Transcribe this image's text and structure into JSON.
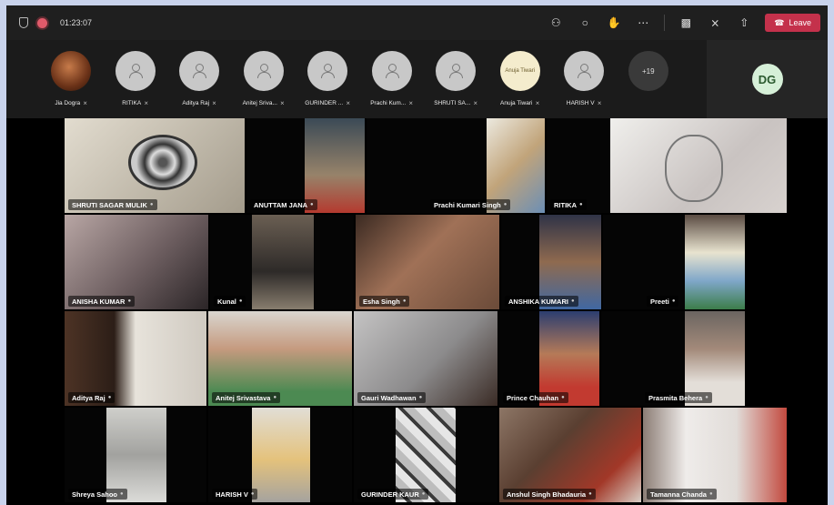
{
  "topbar": {
    "timer": "01:23:07",
    "leave_label": "Leave"
  },
  "strip": {
    "people": [
      {
        "name": "Jia Dogra",
        "kind": "photo"
      },
      {
        "name": "RITIKA",
        "kind": "default"
      },
      {
        "name": "Aditya Raj",
        "kind": "default"
      },
      {
        "name": "Anitej Sriva...",
        "kind": "default"
      },
      {
        "name": "GURINDER ...",
        "kind": "default"
      },
      {
        "name": "Prachi Kum...",
        "kind": "default"
      },
      {
        "name": "SHRUTI SA...",
        "kind": "default"
      },
      {
        "name": "Anuja Tiwari",
        "kind": "named",
        "avatar_text": "Anuja Tiwari"
      },
      {
        "name": "HARISH V",
        "kind": "default"
      }
    ],
    "more_count": "+19",
    "self_initials": "DG"
  },
  "tiles": [
    {
      "name": "SHRUTI SAGAR MULIK",
      "bg": "#bfb7a7"
    },
    {
      "name": "ANUTTAM JANA",
      "bg": "#5d6f7d"
    },
    {
      "name": "Prachi Kumari Singh",
      "bg": "#b4b0a4"
    },
    {
      "name": "RITIKA",
      "bg": "#c9c4be"
    },
    {
      "name": "ANISHA KUMAR",
      "bg": "#7b6a6c"
    },
    {
      "name": "Kunal",
      "bg": "#3e3b38"
    },
    {
      "name": "Esha Singh",
      "bg": "#7a5a46"
    },
    {
      "name": "ANSHIKA KUMARI",
      "bg": "#3a4661"
    },
    {
      "name": "Preeti",
      "bg": "#5b5a57"
    },
    {
      "name": "Aditya Raj",
      "bg": "#5c4333"
    },
    {
      "name": "Anitej Srivastava",
      "bg": "#c4c2bb"
    },
    {
      "name": "Gauri Wadhawan",
      "bg": "#8d8c8c"
    },
    {
      "name": "Prince Chauhan",
      "bg": "#3d4b6a"
    },
    {
      "name": "Prasmita Behera",
      "bg": "#9a8d84"
    },
    {
      "name": "Shreya Sahoo",
      "bg": "#a7a7a3"
    },
    {
      "name": "HARISH V",
      "bg": "#4a4544"
    },
    {
      "name": "GURINDER KAUR",
      "bg": "#b7b5b3"
    },
    {
      "name": "Anshul Singh Bhadauria",
      "bg": "#6c4f40"
    },
    {
      "name": "Tamanna Chanda",
      "bg": "#b2aaa4"
    }
  ]
}
